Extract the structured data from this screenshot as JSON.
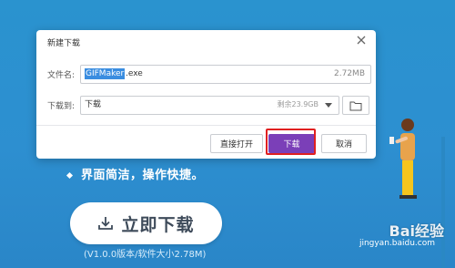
{
  "dialog": {
    "title": "新建下载",
    "filename_label": "文件名:",
    "filename_selected": "GIFMaker",
    "filename_ext": ".exe",
    "filesize": "2.72MB",
    "dir_label": "下载到:",
    "dir_value": "下载",
    "remaining": "剩余23.9GB",
    "buttons": {
      "open": "直接打开",
      "download": "下载",
      "cancel": "取消"
    }
  },
  "page": {
    "feature_text": "界面简洁，操作快捷。",
    "download_label": "立即下载",
    "version_text": "(V1.0.0版本/软件大小2.78M)"
  },
  "watermark": {
    "brand": "Bai经验",
    "url": "jingyan.baidu.com"
  },
  "colors": {
    "background": "#2a93cf",
    "primary_button": "#7b3fb8",
    "highlight": "#e02020"
  }
}
